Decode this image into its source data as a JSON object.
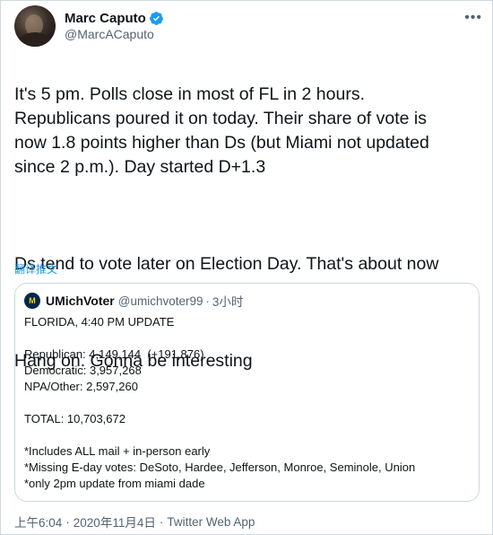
{
  "author": {
    "display_name": "Marc Caputo",
    "handle": "@MarcACaputo",
    "verified_color": "#1d9bf0"
  },
  "tweet": {
    "paragraph_1": "It's 5 pm. Polls close in most of FL in 2 hours.\nRepublicans poured it on today. Their share of vote is\nnow 1.8 points higher than Ds (but Miami not updated\nsince 2 p.m.). Day started D+1.3",
    "paragraph_2": "Ds tend to vote later on Election Day. That's about now",
    "paragraph_3": "Hang on. Gonna be interesting",
    "translate_label": "翻译推文"
  },
  "quote": {
    "display_name": "UMichVoter",
    "handle": "@umichvoter99",
    "separator": "·",
    "time": "3小时",
    "avatar_text": "M",
    "lines": [
      "FLORIDA, 4:40 PM UPDATE",
      "",
      "Republican: 4,149,144  (+191,876)",
      "Democratic: 3,957,268",
      "NPA/Other: 2,597,260",
      "",
      "TOTAL: 10,703,672",
      "",
      "*Includes ALL mail + in-person early",
      "*Missing E-day votes: DeSoto, Hardee, Jefferson, Monroe, Seminole, Union",
      "*only 2pm update from miami dade"
    ]
  },
  "meta": {
    "time": "上午6:04",
    "separator": "·",
    "date": "2020年11月4日",
    "separator_2": "·",
    "source": "Twitter Web App"
  },
  "icons": {
    "verified": "verified-badge-icon",
    "more": "more-options-icon"
  }
}
